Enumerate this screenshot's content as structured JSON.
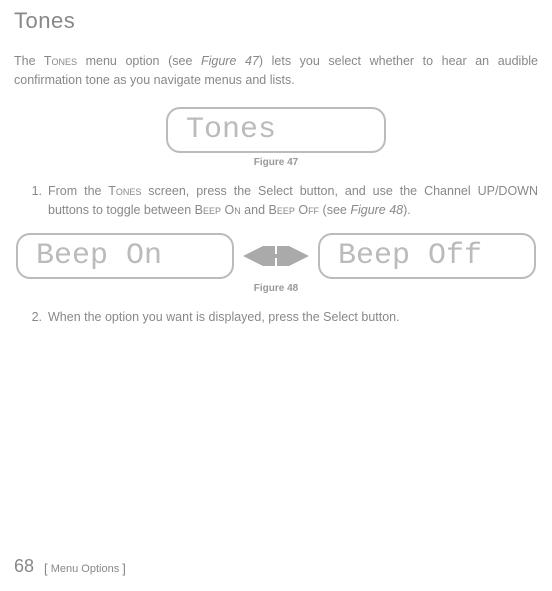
{
  "title": "Tones",
  "intro": {
    "part1": "The T",
    "sc1": "ones",
    "part2": " menu option (see ",
    "figref1": "Figure 47",
    "part3": ") lets you select whether to hear an audible confirmation tone as you navigate menus and lists."
  },
  "figure47": {
    "lcd": "Tones",
    "caption": "Figure 47"
  },
  "steps": {
    "step1": {
      "num": "1.",
      "p1": "From the T",
      "sc1": "ones",
      "p2": " screen, press the Select button, and use the Channel UP/DOWN buttons to toggle between B",
      "sc2": "eep",
      "p3": " O",
      "sc3": "n",
      "p4": " and B",
      "sc4": "eep",
      "p5": " O",
      "sc5": "ff",
      "p6": " (see ",
      "figref": "Figure 48",
      "p7": ")."
    },
    "step2": {
      "num": "2.",
      "text": "When the option you want is displayed, press the Select button."
    }
  },
  "figure48": {
    "lcd_left": "Beep On",
    "lcd_right": "Beep Off",
    "caption": "Figure 48"
  },
  "footer": {
    "page": "68",
    "label": "Menu Options"
  }
}
